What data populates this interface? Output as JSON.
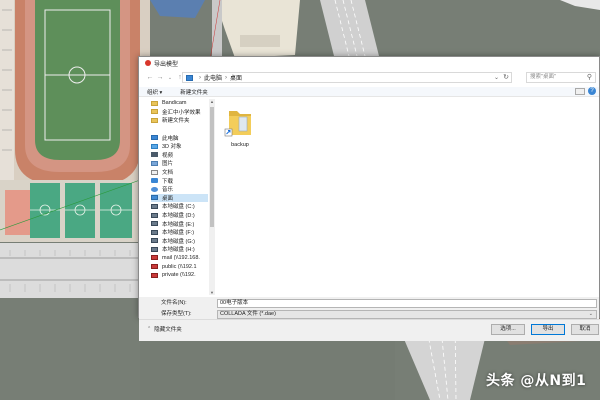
{
  "dialog": {
    "title": "导出模型",
    "address": {
      "crumbs": [
        "此电脑",
        "桌面"
      ],
      "search_placeholder": "搜索\"桌面\""
    },
    "toolbar": {
      "organize_label": "组织 ▾",
      "new_folder_label": "新建文件夹"
    },
    "nav_items": [
      {
        "label": "Bandicam",
        "icon": "folder-icon"
      },
      {
        "label": "金汇中小学效果",
        "icon": "folder-icon"
      },
      {
        "label": "新建文件夹",
        "icon": "folder-icon"
      },
      {
        "label": "",
        "icon": ""
      },
      {
        "label": "此电脑",
        "icon": "computer-icon"
      },
      {
        "label": "3D 对象",
        "icon": "3d-objects-icon"
      },
      {
        "label": "视频",
        "icon": "video-icon"
      },
      {
        "label": "图片",
        "icon": "pictures-icon"
      },
      {
        "label": "文档",
        "icon": "documents-icon"
      },
      {
        "label": "下载",
        "icon": "downloads-icon"
      },
      {
        "label": "音乐",
        "icon": "music-icon"
      },
      {
        "label": "桌面",
        "icon": "desktop-icon",
        "selected": true
      },
      {
        "label": "本地磁盘 (C:)",
        "icon": "disk-icon"
      },
      {
        "label": "本地磁盘 (D:)",
        "icon": "disk-icon"
      },
      {
        "label": "本地磁盘 (E:)",
        "icon": "disk-icon"
      },
      {
        "label": "本地磁盘 (F:)",
        "icon": "disk-icon"
      },
      {
        "label": "本地磁盘 (G:)",
        "icon": "disk-icon"
      },
      {
        "label": "本地磁盘 (H:)",
        "icon": "disk-icon"
      },
      {
        "label": "mail (\\\\192.168.",
        "icon": "network-drive-icon"
      },
      {
        "label": "public (\\\\192.1",
        "icon": "network-drive-icon"
      },
      {
        "label": "private (\\\\192.",
        "icon": "network-drive-icon"
      }
    ],
    "files": [
      {
        "name": "backup",
        "icon": "folder-shortcut-icon"
      }
    ],
    "filename_label": "文件名(N):",
    "filename_value": "00电子版本",
    "filetype_label": "保存类型(T):",
    "filetype_value": "COLLADA 文件 (*.dae)",
    "hide_folders_label": "隐藏文件夹",
    "options_button": "选项...",
    "export_button": "导出",
    "cancel_button": "取消"
  },
  "watermark": "头条 @从N到1",
  "colors": {
    "accent": "#0078d7",
    "selection": "#cce4f7",
    "folder": "#e9c45a"
  }
}
